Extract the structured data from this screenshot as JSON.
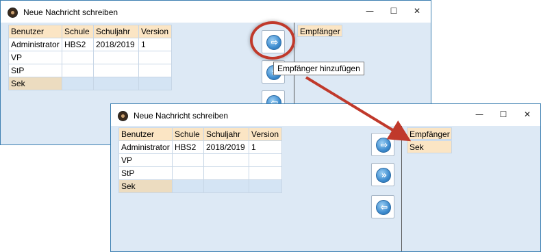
{
  "window_title": "Neue Nachricht schreiben",
  "window_controls": {
    "minimize": "—",
    "maximize": "☐",
    "close": "✕"
  },
  "table": {
    "columns": [
      "Benutzer",
      "Schule",
      "Schuljahr",
      "Version"
    ],
    "rows": [
      [
        "Administrator",
        "HBS2",
        "2018/2019",
        "1"
      ],
      [
        "VP",
        "",
        "",
        ""
      ],
      [
        "StP",
        "",
        "",
        ""
      ],
      [
        "Sek",
        "",
        "",
        ""
      ]
    ]
  },
  "recipients": {
    "header": "Empfänger",
    "before": [],
    "after": [
      "Sek"
    ]
  },
  "tooltip": "Empfänger hinzufügen",
  "buttons": {
    "add": "⇨",
    "add_all": "»",
    "remove": "⇦"
  },
  "colors": {
    "header_bg": "#fbe5c4",
    "panel_bg": "#dde9f5",
    "accent_arrow": "#c0392b",
    "window_border": "#3c7fb1"
  }
}
